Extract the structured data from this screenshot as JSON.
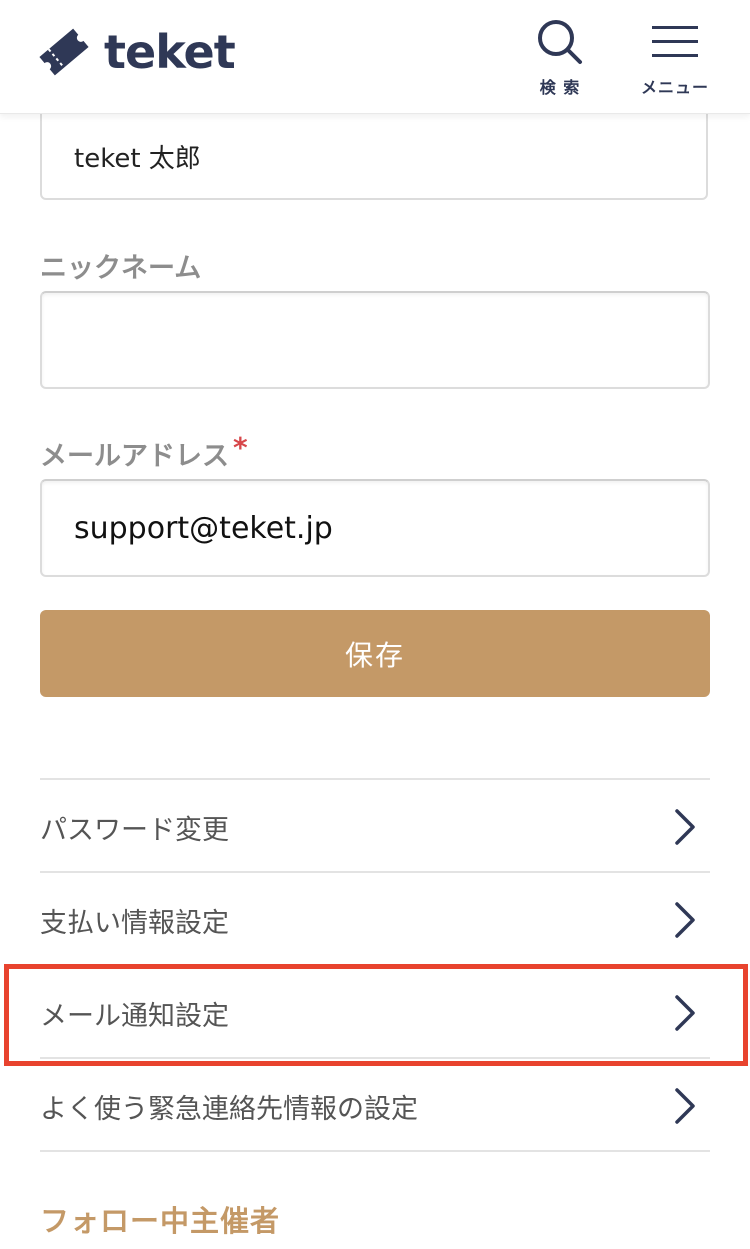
{
  "header": {
    "logo_text": "teket",
    "logo_icon": "ticket-icon",
    "search_label": "検 索",
    "menu_label": "メニュー",
    "brand_color": "#2f3856"
  },
  "form": {
    "name_value": "teket 太郎",
    "nickname_label": "ニックネーム",
    "nickname_value": "",
    "email_label": "メールアドレス",
    "required_mark": "*",
    "email_value": "support@teket.jp",
    "save_label": "保存",
    "save_color": "#c49967"
  },
  "settings": {
    "items": [
      {
        "label": "パスワード変更",
        "icon": "chevron-right-icon"
      },
      {
        "label": "支払い情報設定",
        "icon": "chevron-right-icon"
      },
      {
        "label": "メール通知設定",
        "icon": "chevron-right-icon",
        "highlighted": true
      },
      {
        "label": "よく使う緊急連絡先情報の設定",
        "icon": "chevron-right-icon"
      }
    ]
  },
  "section": {
    "following_organizers_title": "フォロー中主催者"
  },
  "highlight_color": "#e8432e"
}
